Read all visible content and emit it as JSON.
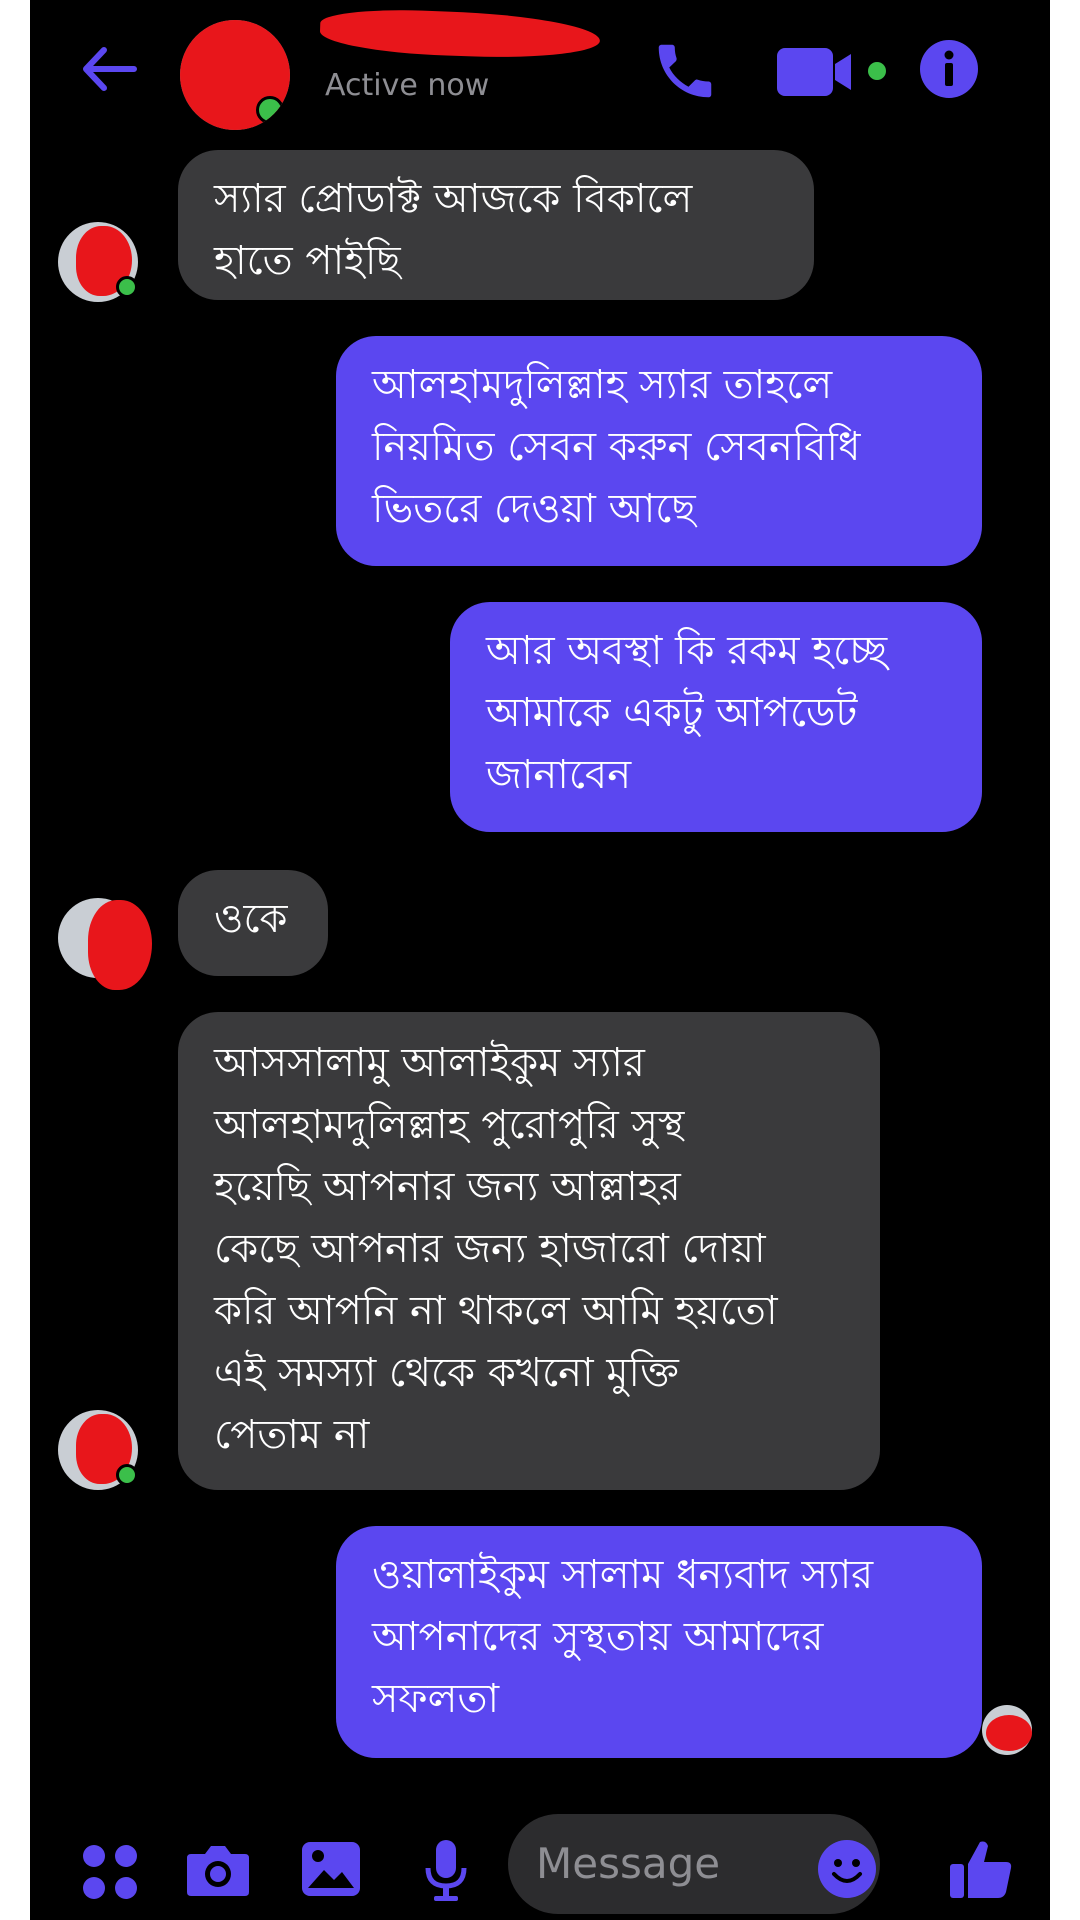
{
  "header": {
    "contact_name": "",
    "status": "Active now"
  },
  "composer": {
    "placeholder": "Message"
  },
  "messages": [
    {
      "from": "contact",
      "text": "স্যার প্রোডাক্ট আজকে বিকালে\nহাতে পাইছি"
    },
    {
      "from": "me",
      "text": "আলহামদুলিল্লাহ স্যার তাহলে\nনিয়মিত সেবন করুন সেবনবিধি\nভিতরে দেওয়া আছে"
    },
    {
      "from": "me",
      "text": "আর অবস্থা কি রকম হচ্ছে\nআমাকে একটু আপডেট\nজানাবেন"
    },
    {
      "from": "contact",
      "text": "ওকে"
    },
    {
      "from": "contact",
      "text": "আসসালামু আলাইকুম স্যার\nআলহামদুলিল্লাহ পুরোপুরি সুস্থ\nহয়েছি আপনার জন্য আল্লাহর\nকেছে আপনার জন্য হাজারো দোয়া\nকরি আপনি না থাকলে আমি হয়তো\nএই সমস্যা থেকে কখনো মুক্তি\nপেতাম না"
    },
    {
      "from": "me",
      "text": "ওয়ালাইকুম সালাম ধন্যবাদ স্যার\nআপনাদের সুস্থতায় আমাদের\nসফলতা"
    }
  ],
  "icons": {
    "back": "back-arrow-icon",
    "call": "phone-icon",
    "video": "video-camera-icon",
    "info": "info-icon",
    "menu": "grid-menu-icon",
    "camera": "camera-icon",
    "gallery": "image-icon",
    "mic": "microphone-icon",
    "emoji": "emoji-icon",
    "like": "thumbs-up-icon"
  },
  "colors": {
    "accent": "#5b47f0",
    "incoming_bubble": "#3a3a3c",
    "background": "#000000",
    "online": "#3bbf4a",
    "redaction": "#e8161b"
  }
}
